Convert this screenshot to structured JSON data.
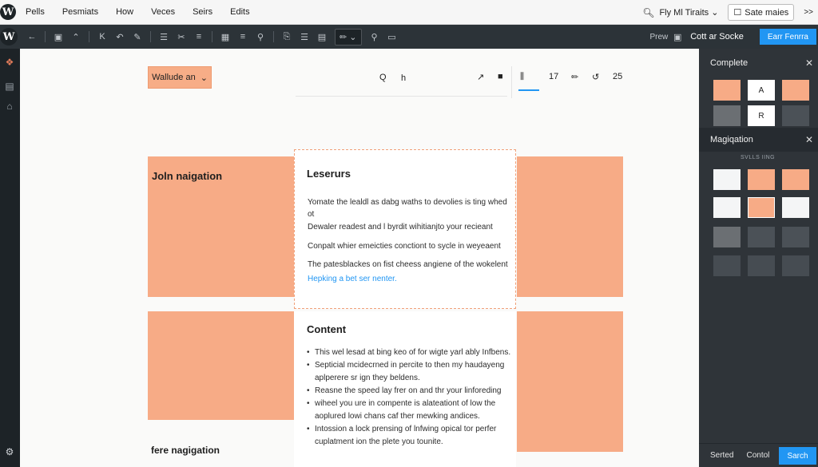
{
  "menu": [
    "Pells",
    "Pesmiats",
    "How",
    "Veces",
    "Seirs",
    "Edits"
  ],
  "topbar": {
    "site_label": "Fly Ml Tiraits",
    "save_label": "Sate maies",
    "more_label": ">>"
  },
  "toolbar": {
    "preview_label": "Prew",
    "panel_label": "Cott ar Socke",
    "publish_label": "Earr Fenrra"
  },
  "canvas": {
    "style_dropdown": "Wallude an",
    "block_toolbar": {
      "search": "Q",
      "heading": "h",
      "count1": "17",
      "count2": "25"
    },
    "left_label_top": "Joln naigation",
    "left_label_bottom": "fere nagigation",
    "card1": {
      "title": "Leserurs",
      "lines": [
        "Yomate the lealdl as dabg waths to devolies is ting whed",
        "ot",
        "Dewaler readest and l byrdit wihitianjto your recieant",
        "Conpalt whier emeicties conctiont to sycle in weyeaent",
        "The patesblackes on fist cheess angiene of the wokelent"
      ],
      "link": "Hepking a bet ser nenter."
    },
    "card2": {
      "title": "Content",
      "bullets": [
        "This wel lesad at bing keo of for wigte yarl ably Infbens.",
        "Septicial mcidecrned in percite to then my haudayeng",
        "aplperere sr ign they beldens.",
        "Reasne the speed lay frer on and thr your linforeding",
        "wiheel you ure in compente is alateationt of low the",
        "aoplured lowi chans caf ther mewking andices.",
        "Intossion a lock prensing of lnfwing opical tor perfer",
        "cuplatment ion the plete you tounite."
      ]
    }
  },
  "sidebar": {
    "panel1_title": "Complete",
    "panel1_swatches": [
      "",
      "A",
      "",
      "",
      "R",
      ""
    ],
    "panel2_title": "Magiqation",
    "panel2_sub_label": "SVLLS     IING",
    "footer_items": [
      "Serted",
      "Contol"
    ],
    "footer_button": "Sarch"
  },
  "colors": {
    "peach": "#f7ab86",
    "accent_blue": "#2196f3",
    "sidebar_bg": "#2f3439",
    "toolbar_bg": "#2c3338"
  }
}
